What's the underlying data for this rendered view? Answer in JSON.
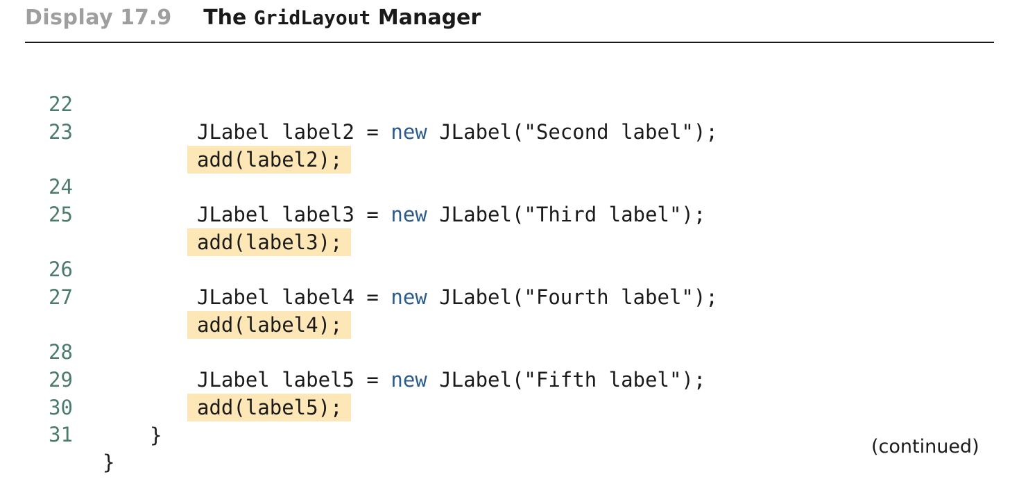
{
  "header": {
    "display_label": "Display",
    "display_number": "17.9",
    "title_prefix": "The",
    "title_mono": "GridLayout",
    "title_suffix": "Manager"
  },
  "code_lines": [
    {
      "num": "22",
      "pre": "JLabel label2 = ",
      "kw": "new",
      "post": " JLabel(\"Second label\");",
      "highlight": false
    },
    {
      "num": "23",
      "text": "add(label2);",
      "highlight": true
    },
    {
      "num": "24",
      "pre": "JLabel label3 = ",
      "kw": "new",
      "post": " JLabel(\"Third label\");",
      "highlight": false
    },
    {
      "num": "25",
      "text": "add(label3);",
      "highlight": true
    },
    {
      "num": "26",
      "pre": "JLabel label4 = ",
      "kw": "new",
      "post": " JLabel(\"Fourth label\");",
      "highlight": false
    },
    {
      "num": "27",
      "text": "add(label4);",
      "highlight": true
    },
    {
      "num": "28",
      "pre": "JLabel label5 = ",
      "kw": "new",
      "post": " JLabel(\"Fifth label\");",
      "highlight": false
    },
    {
      "num": "29",
      "text": "add(label5);",
      "highlight": true
    },
    {
      "num": "30",
      "text": "}",
      "highlight": false
    },
    {
      "num": "31",
      "text": "}",
      "highlight": false
    }
  ],
  "footer": {
    "continued": "(continued)"
  },
  "colors": {
    "highlight": "#fde7b7",
    "keyword": "#2a5b8a",
    "line_number": "#4b7a6e"
  }
}
